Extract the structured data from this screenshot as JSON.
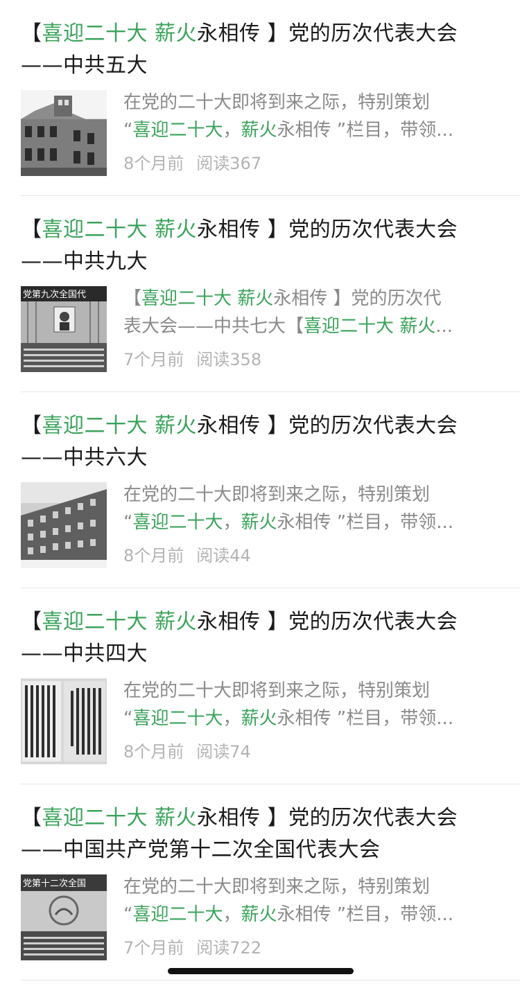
{
  "articles": [
    {
      "title": {
        "bracket_open": "【",
        "hl1": "喜迎二十大 薪火",
        "mid": "永相传 】党的历次代表大会",
        "line2": "——中共五大"
      },
      "summary": {
        "line1": "在党的二十大即将到来之际，特别策划",
        "l2_pre": "“",
        "l2_hl1": "喜迎二十大",
        "l2_sep": "，",
        "l2_hl2": "薪火",
        "l2_post": "永相传 ”栏目，带领..."
      },
      "time": "8个月前",
      "reads": "阅读367",
      "thumb_icon": "building-photo-icon"
    },
    {
      "title": {
        "bracket_open": "【",
        "hl1": "喜迎二十大 薪火",
        "mid": "永相传 】党的历次代表大会",
        "line2": "——中共九大"
      },
      "summary": {
        "line1_pre": "【",
        "line1_hl": "喜迎二十大 薪火",
        "line1_post": "永相传 】党的历次代",
        "line2_pre": "表大会——中共七大【",
        "line2_hl": "喜迎二十大 薪火",
        "line2_post": "..."
      },
      "time": "7个月前",
      "reads": "阅读358",
      "thumb_icon": "congress-hall-photo-icon",
      "thumb_banner": "党第九次全国代"
    },
    {
      "title": {
        "bracket_open": "【",
        "hl1": "喜迎二十大 薪火",
        "mid": "永相传 】党的历次代表大会",
        "line2": "——中共六大"
      },
      "summary": {
        "line1": "在党的二十大即将到来之际，特别策划",
        "l2_pre": "“",
        "l2_hl1": "喜迎二十大",
        "l2_sep": "，",
        "l2_hl2": "薪火",
        "l2_post": "永相传 ”栏目，带领..."
      },
      "time": "8个月前",
      "reads": "阅读44",
      "thumb_icon": "building-photo-icon"
    },
    {
      "title": {
        "bracket_open": "【",
        "hl1": "喜迎二十大 薪火",
        "mid": "永相传 】党的历次代表大会",
        "line2": "——中共四大"
      },
      "summary": {
        "line1": "在党的二十大即将到来之际，特别策划",
        "l2_pre": "“",
        "l2_hl1": "喜迎二十大",
        "l2_sep": "，",
        "l2_hl2": "薪火",
        "l2_post": "永相传 ”栏目，带领..."
      },
      "time": "8个月前",
      "reads": "阅读74",
      "thumb_icon": "document-photo-icon"
    },
    {
      "title": {
        "bracket_open": "【",
        "hl1": "喜迎二十大 薪火",
        "mid": "永相传 】党的历次代表大会",
        "line2": "——中国共产党第十二次全国代表大会"
      },
      "summary": {
        "line1": "在党的二十大即将到来之际，特别策划",
        "l2_pre": "“",
        "l2_hl1": "喜迎二十大",
        "l2_sep": "，",
        "l2_hl2": "薪火",
        "l2_post": "永相传 ”栏目，带领..."
      },
      "time": "7个月前",
      "reads": "阅读722",
      "thumb_icon": "congress-hall-photo-icon",
      "thumb_banner": "党第十二次全国"
    }
  ],
  "colors": {
    "highlight": "#3aa35a",
    "title": "#1a1a1a",
    "summary": "#8a8a8a",
    "meta": "#b3b3b3"
  }
}
